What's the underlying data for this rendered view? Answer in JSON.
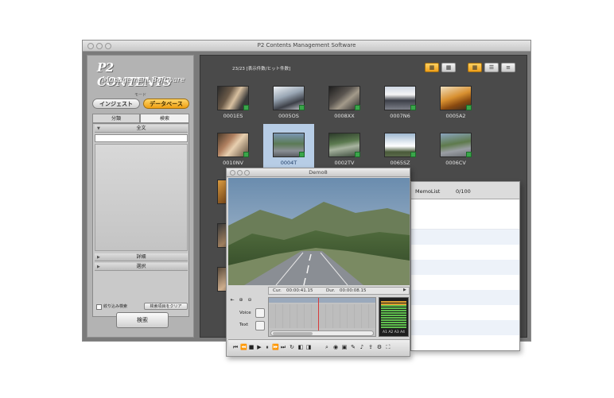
{
  "window": {
    "title": "P2 Contents Management Software"
  },
  "logo": {
    "line1": "P2 CONTENTS",
    "line2": "Management Software"
  },
  "sidebar": {
    "mode_label": "モード",
    "modes": [
      {
        "label": "インジェスト"
      },
      {
        "label": "データベース"
      }
    ],
    "tabs": [
      {
        "label": "分類"
      },
      {
        "label": "検索"
      }
    ],
    "sections": [
      {
        "label": "全文"
      },
      {
        "label": "詳細"
      },
      {
        "label": "選択"
      }
    ],
    "refine_label": "絞り込み検索",
    "clear_label": "検索項目をクリア",
    "search_button": "検索"
  },
  "content": {
    "result_count": "23/23 [表示件数/ヒット件数]",
    "clips": [
      {
        "name": "0001ES"
      },
      {
        "name": "0005OS"
      },
      {
        "name": "0008XX"
      },
      {
        "name": "0007N6"
      },
      {
        "name": "0005A2"
      },
      {
        "name": "0010NV"
      },
      {
        "name": "0004T"
      },
      {
        "name": "0002TV"
      },
      {
        "name": "0065SZ"
      },
      {
        "name": "0006CV"
      }
    ]
  },
  "player": {
    "title": "Demo8",
    "cur_label": "Cur.",
    "cur_value": "00:00:41.15",
    "dur_label": "Dur.",
    "dur_value": "00:00:08.15",
    "voice_label": "Voice",
    "text_label": "Text",
    "meter_labels": "A1 A2 A3 A4"
  },
  "memo": {
    "label": "MemoList",
    "count": "0/100"
  },
  "colors": {
    "accent": "#f0a012",
    "selected": "#b7cde6",
    "content_bg": "#4a4a4a"
  }
}
